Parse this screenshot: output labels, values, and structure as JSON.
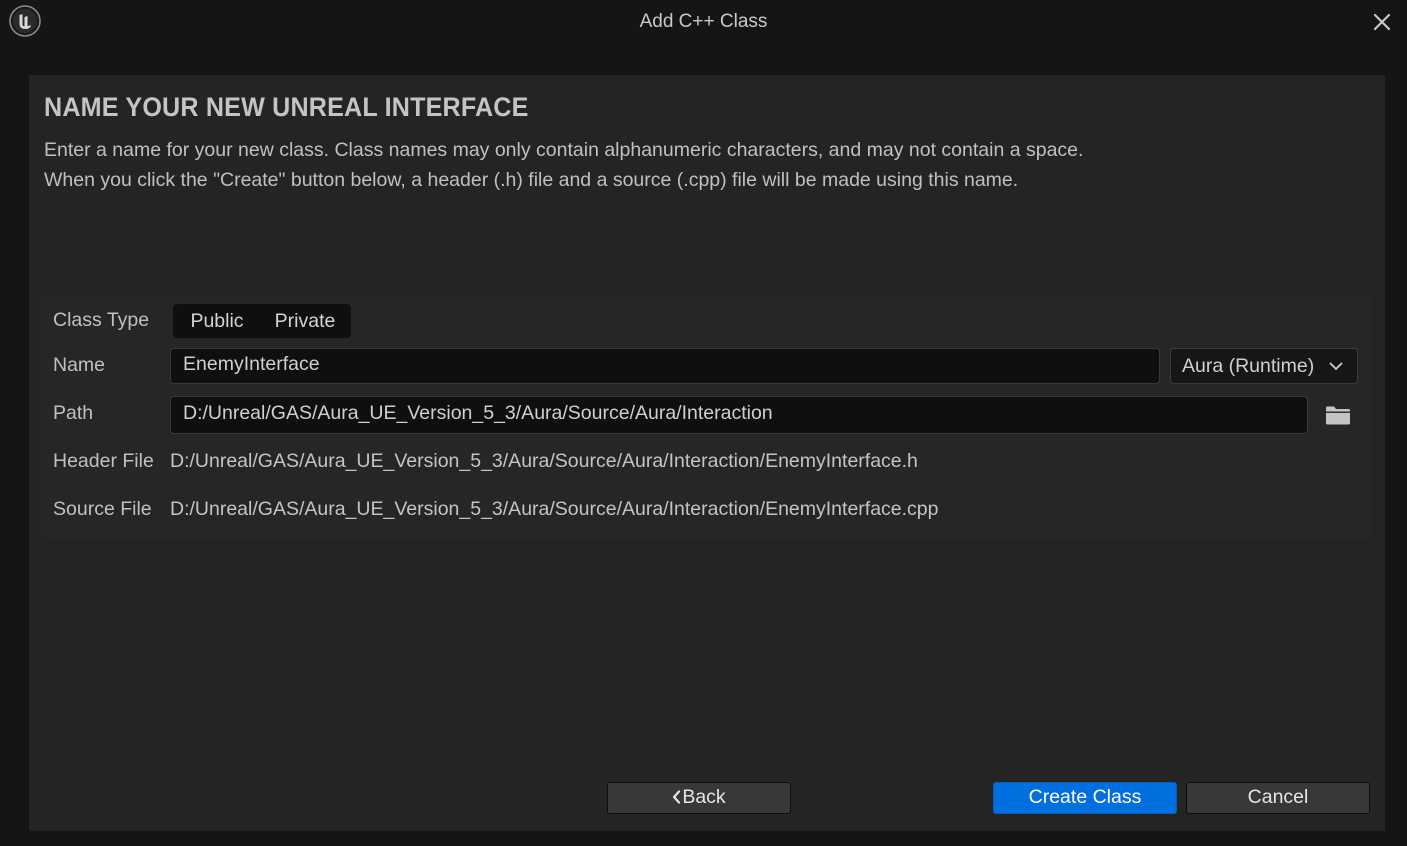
{
  "window": {
    "title": "Add C++ Class",
    "logo_icon": "unreal-engine-logo",
    "close_icon": "close-icon"
  },
  "page": {
    "heading": "NAME YOUR NEW UNREAL INTERFACE",
    "description_line1": "Enter a name for your new class. Class names may only contain alphanumeric characters, and may not contain a space.",
    "description_line2": "When you click the \"Create\" button below, a header (.h) file and a source (.cpp) file will be made using this name."
  },
  "form": {
    "class_type": {
      "label": "Class Type",
      "options": [
        "Public",
        "Private"
      ]
    },
    "name": {
      "label": "Name",
      "value": "EnemyInterface",
      "module": "Aura (Runtime)"
    },
    "path": {
      "label": "Path",
      "value": "D:/Unreal/GAS/Aura_UE_Version_5_3/Aura/Source/Aura/Interaction",
      "browse_icon": "folder-icon"
    },
    "header_file": {
      "label": "Header File",
      "value": "D:/Unreal/GAS/Aura_UE_Version_5_3/Aura/Source/Aura/Interaction/EnemyInterface.h"
    },
    "source_file": {
      "label": "Source File",
      "value": "D:/Unreal/GAS/Aura_UE_Version_5_3/Aura/Source/Aura/Interaction/EnemyInterface.cpp"
    }
  },
  "buttons": {
    "back": "Back",
    "create": "Create Class",
    "cancel": "Cancel"
  },
  "colors": {
    "background": "#151515",
    "panel": "#242424",
    "accent": "#0070e0"
  }
}
